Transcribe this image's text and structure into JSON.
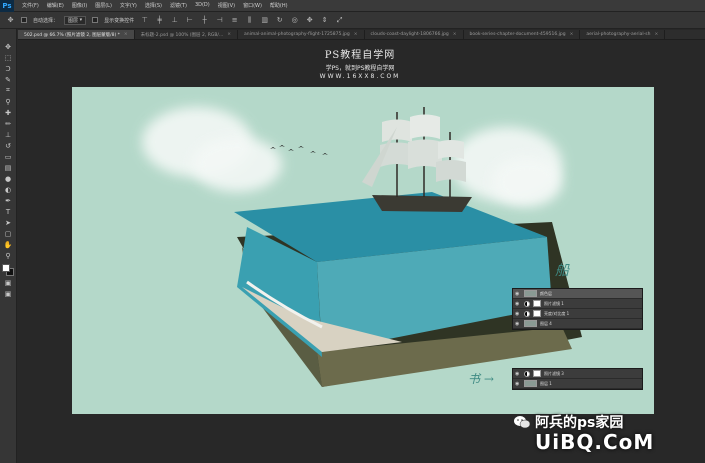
{
  "app": {
    "logo": "Ps"
  },
  "menu": [
    "文件(F)",
    "编辑(E)",
    "图像(I)",
    "图层(L)",
    "文字(Y)",
    "选择(S)",
    "滤镜(T)",
    "3D(D)",
    "视图(V)",
    "窗口(W)",
    "帮助(H)"
  ],
  "options_bar": {
    "auto_select_label": "自动选择：",
    "auto_select_value": "图层",
    "show_transform_label": "显示变换控件"
  },
  "tabs": [
    {
      "label": "502.psd @ 66.7% (照片滤镜 2, 图层蒙版/8) *",
      "active": true
    },
    {
      "label": "未标题-2.psd @ 100% (图层 2, RGB/..."
    },
    {
      "label": "animal-animal-photography-flight-1725875.jpg"
    },
    {
      "label": "clouds-coast-daylight-1806766.jpg"
    },
    {
      "label": "book-series-chapter-document-459516.jpg"
    },
    {
      "label": "aerial-photography-aerial-sh"
    }
  ],
  "tools": [
    "move-icon",
    "marquee-icon",
    "lasso-icon",
    "quick-select-icon",
    "crop-icon",
    "eyedropper-icon",
    "healing-icon",
    "brush-icon",
    "stamp-icon",
    "history-brush-icon",
    "eraser-icon",
    "gradient-icon",
    "blur-icon",
    "dodge-icon",
    "pen-icon",
    "type-icon",
    "path-select-icon",
    "shape-icon",
    "hand-icon",
    "zoom-icon"
  ],
  "watermark": {
    "title": "PS教程自学网",
    "subtitle": "学PS，就到PS教程自学网",
    "url": "WWW.16XX8.COM"
  },
  "layers_ship": [
    {
      "name": "颜色层",
      "type": "thumb"
    },
    {
      "name": "照片滤镜 1",
      "type": "adj"
    },
    {
      "name": "亮度/对比度 1",
      "type": "adj"
    },
    {
      "name": "图层 4",
      "type": "thumb"
    }
  ],
  "layers_book": [
    {
      "name": "照片滤镜 3",
      "type": "adj"
    },
    {
      "name": "图层 1",
      "type": "thumb"
    }
  ],
  "annotations": {
    "ship": "船",
    "book": "书 →"
  },
  "brand": {
    "name": "阿兵的ps家园",
    "url": "UiBQ.CoM"
  }
}
